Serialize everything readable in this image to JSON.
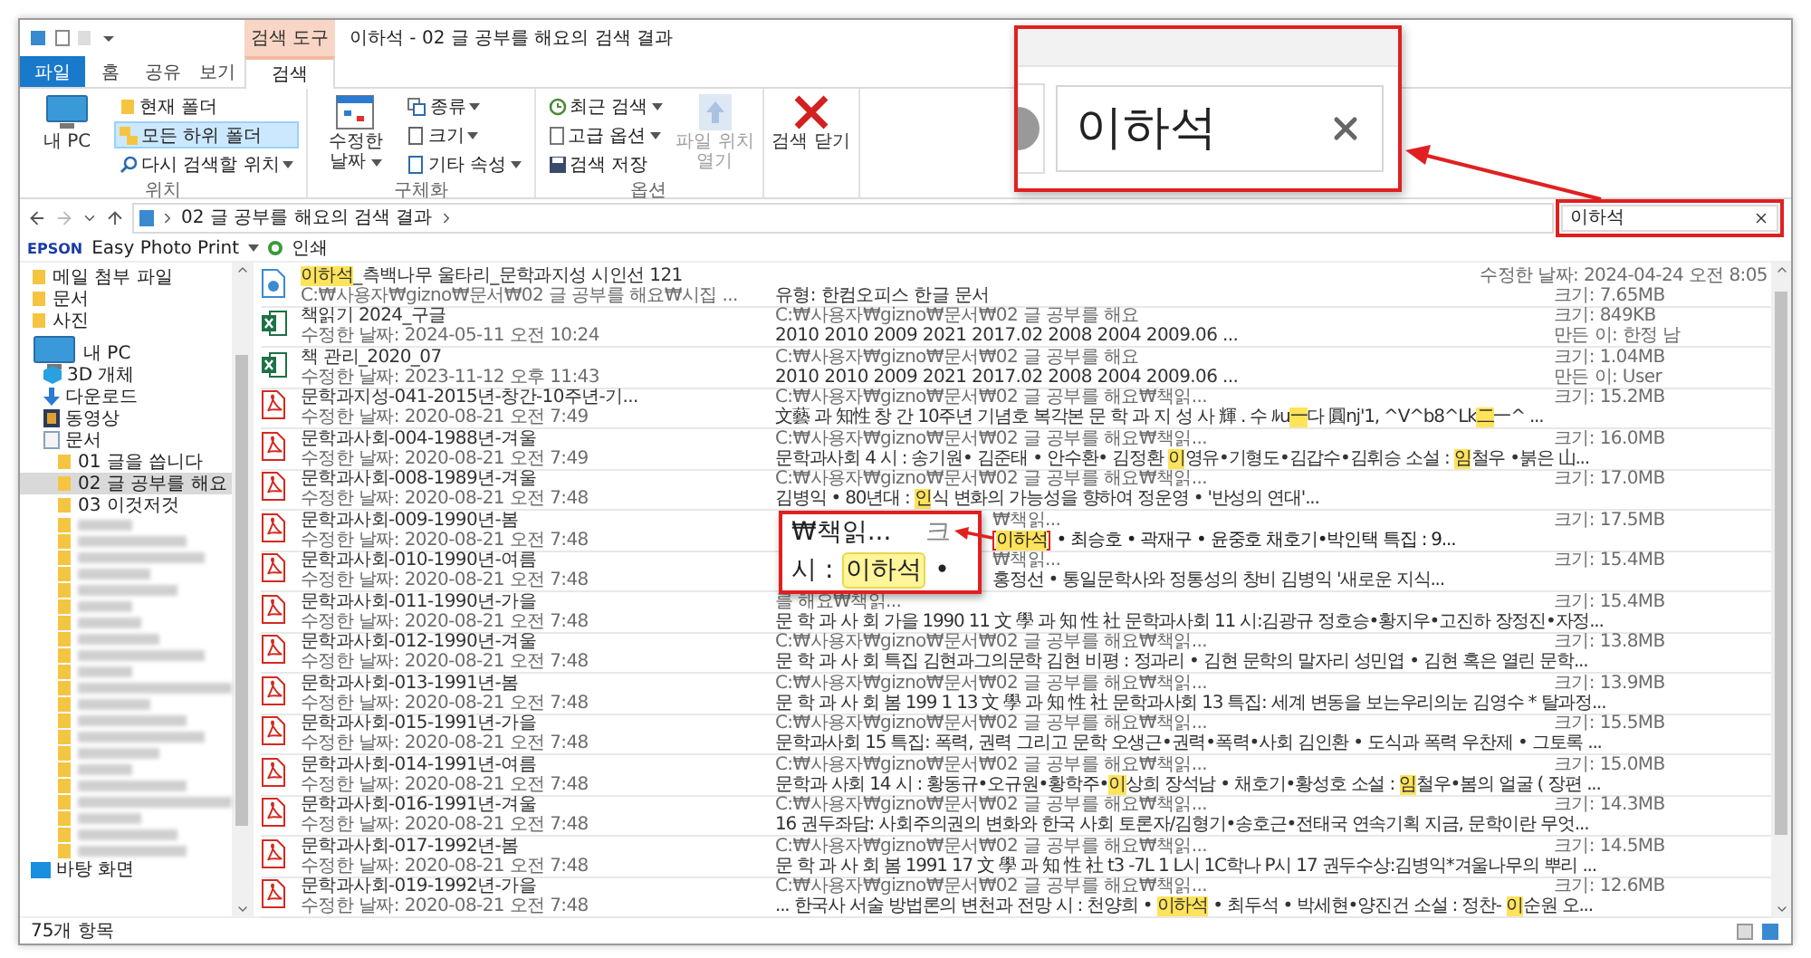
{
  "window": {
    "title": "이하석 - 02 글 공부를 해요의 검색 결과",
    "context_tab": "검색 도구"
  },
  "ribbon_tabs": [
    {
      "label": "파일",
      "kind": "file",
      "selected": false
    },
    {
      "label": "홈",
      "kind": "tab",
      "selected": false
    },
    {
      "label": "공유",
      "kind": "tab",
      "selected": false
    },
    {
      "label": "보기",
      "kind": "tab",
      "selected": false
    },
    {
      "label": "검색",
      "kind": "tab",
      "selected": true
    }
  ],
  "ribbon_groups": [
    {
      "label": "위치",
      "large": [
        {
          "label": "내 PC",
          "disabled": false,
          "dropdown": false
        }
      ],
      "small": [
        {
          "label": "현재 폴더",
          "selected": false,
          "dropdown": false
        },
        {
          "label": "모든 하위 폴더",
          "selected": true,
          "dropdown": false
        },
        {
          "label": "다시 검색할 위치",
          "selected": false,
          "dropdown": true
        }
      ]
    },
    {
      "label": "구체화",
      "large": [
        {
          "label": "수정한 날짜",
          "disabled": false,
          "dropdown": true
        }
      ],
      "small": [
        {
          "label": "종류",
          "selected": false,
          "dropdown": true
        },
        {
          "label": "크기",
          "selected": false,
          "dropdown": true
        },
        {
          "label": "기타 속성",
          "selected": false,
          "dropdown": true
        }
      ]
    },
    {
      "label": "옵션",
      "small": [
        {
          "label": "최근 검색",
          "selected": false,
          "dropdown": true
        },
        {
          "label": "고급 옵션",
          "selected": false,
          "dropdown": true
        },
        {
          "label": "검색 저장",
          "selected": false,
          "dropdown": false
        }
      ],
      "after": [
        {
          "label": "파일 위치 열기",
          "disabled": true
        }
      ]
    },
    {
      "large": [
        {
          "label": "검색 닫기",
          "disabled": false,
          "dropdown": false
        }
      ]
    }
  ],
  "address": {
    "path": "02 글 공부를 해요의 검색 결과"
  },
  "search": {
    "value": "이하석"
  },
  "epson_bar": {
    "brand": "EPSON",
    "app": "Easy Photo Print",
    "print": "인쇄"
  },
  "nav": [
    {
      "label": "메일 첨부 파일",
      "selected": false
    },
    {
      "label": "문서",
      "selected": false
    },
    {
      "label": "사진",
      "selected": false
    },
    {
      "label": "내 PC",
      "selected": false,
      "children": [
        {
          "label": "3D 개체",
          "selected": false
        },
        {
          "label": "다운로드",
          "selected": false
        },
        {
          "label": "동영상",
          "selected": false
        },
        {
          "label": "문서",
          "selected": false,
          "children": [
            {
              "label": "01 글을 씁니다",
              "selected": false
            },
            {
              "label": "02 글 공부를 해요",
              "selected": true
            },
            {
              "label": "03 이것저것",
              "selected": false
            },
            {
              "kind": "blurred",
              "selected": false
            },
            {
              "kind": "blurred",
              "selected": false
            },
            {
              "kind": "blurred",
              "selected": false
            },
            {
              "kind": "blurred",
              "selected": false
            },
            {
              "kind": "blurred",
              "selected": false
            },
            {
              "kind": "blurred",
              "selected": false
            },
            {
              "kind": "blurred",
              "selected": false
            },
            {
              "kind": "blurred",
              "selected": false
            },
            {
              "kind": "blurred",
              "selected": false
            },
            {
              "kind": "blurred",
              "selected": false
            },
            {
              "kind": "blurred",
              "selected": false
            },
            {
              "kind": "blurred",
              "selected": false
            },
            {
              "kind": "blurred",
              "selected": false
            },
            {
              "kind": "blurred",
              "selected": false
            },
            {
              "kind": "blurred",
              "selected": false
            },
            {
              "kind": "blurred",
              "selected": false
            },
            {
              "kind": "blurred",
              "selected": false
            },
            {
              "kind": "blurred",
              "selected": false
            },
            {
              "kind": "blurred",
              "selected": false
            },
            {
              "kind": "blurred",
              "selected": false
            },
            {
              "kind": "blurred",
              "selected": false
            }
          ]
        }
      ]
    },
    {
      "label": "바탕 화면",
      "selected": false
    }
  ],
  "rows": [
    {
      "kind": "hwp",
      "name": "**이하석**_측백나무 울타리_문학과지성 시인선 121",
      "info": "C:₩사용자₩gizno₩문서₩02 글 공부를 해요₩시집 ...",
      "bottom_mid": "유형: 한컴오피스 한글 문서",
      "top_right": "수정한 날짜: 2024-04-24 오전 8:05",
      "bottom_right": "크기: 7.65MB"
    },
    {
      "kind": "excel",
      "name": "책읽기 2024_구글",
      "info": "수정한 날짜: 2024-05-11 오전 10:24",
      "top_mid": "C:₩사용자₩gizno₩문서₩02 글 공부를 해요",
      "bottom_mid": "2010 2010 2009 2021 2017.02 2008 2004 2009.06 ...",
      "top_right": "크기: 849KB",
      "bottom_right": "만든 이: 한정 남"
    },
    {
      "kind": "excel",
      "name": "책 관리_2020_07",
      "info": "수정한 날짜: 2023-11-12 오후 11:43",
      "top_mid": "C:₩사용자₩gizno₩문서₩02 글 공부를 해요",
      "bottom_mid": "2010 2010 2009 2021 2017.02 2008 2004 2009.06 ...",
      "top_right": "크기: 1.04MB",
      "bottom_right": "만든 이: User"
    },
    {
      "kind": "pdf",
      "name": "문학과지성-041-2015년-창간-10주년-기...",
      "info": "수정한 날짜: 2020-08-21 오전 7:49",
      "top_mid": "C:₩사용자₩gizno₩문서₩02 글 공부를 해요₩책읽...",
      "top_right": "크기: 15.2MB",
      "bottom_mid": "文藝 과 知性 창 간 10주년 기념호 복각본 문 학 과 지 성 사 輝 . 수 ﾙu**一**다 圓nj'1, ^V^b8^Lk**二**一^ ..."
    },
    {
      "kind": "pdf",
      "name": "문학과사회-004-1988년-겨울",
      "info": "수정한 날짜: 2020-08-21 오전 7:49",
      "top_mid": "C:₩사용자₩gizno₩문서₩02 글 공부를 해요₩책읽...",
      "top_right": "크기: 16.0MB",
      "bottom_mid": "문학과사회 4 시 : 송기원• 김준태 • 안수환• 김정환 **이**영유•기형도•김갑수•김휘승 소설 : **임**철우 •붉은 山..."
    },
    {
      "kind": "pdf",
      "name": "문학과사회-008-1989년-겨울",
      "info": "수정한 날짜: 2020-08-21 오전 7:48",
      "top_mid": "C:₩사용자₩gizno₩문서₩02 글 공부를 해요₩책읽...",
      "top_right": "크기: 17.0MB",
      "bottom_mid": "김병익 • 80년대 : **인**식 변화의 가능성을 향하여 정운영 • '반성의 연대'..."
    },
    {
      "kind": "pdf",
      "behind_callout": true,
      "name": "문학과사회-009-1990년-봄",
      "info": "수정한 날짜: 2020-08-21 오전 7:48",
      "top_mid": "₩책읽...",
      "top_right": "크기: 17.5MB",
      "marked": "**이하석**",
      "bottom_mid": "• 최승호 • 곽재구 • 윤중호 채호기•박인택 특집 : 9...",
      "zoom": {
        "path": "₩책읽...",
        "label": "크",
        "prefix": "시 :",
        "match": "이하석",
        "bullet": "•"
      }
    },
    {
      "kind": "pdf",
      "behind_callout": true,
      "name": "문학과사회-010-1990년-여름",
      "info": "수정한 날짜: 2020-08-21 오전 7:48",
      "top_mid": "₩책읽...",
      "top_right": "크기: 15.4MB",
      "bottom_mid": "홍정선 • 통일문학사와 정통성의 창비 김병익 '새로운 지식..."
    },
    {
      "kind": "pdf",
      "name": "문학과사회-011-1990년-가을",
      "info": "수정한 날짜: 2020-08-21 오전 7:48",
      "top_mid": "를 해요₩책읽...",
      "top_right": "크기: 15.4MB",
      "bottom_mid": "문 학 과 사 회 가을 1990 11 文 學 과 知 性 社 문학과사회 11 시:김광규 정호승•황지우•고진하 장정진•자정..."
    },
    {
      "kind": "pdf",
      "name": "문학과사회-012-1990년-겨울",
      "info": "수정한 날짜: 2020-08-21 오전 7:48",
      "top_mid": "C:₩사용자₩gizno₩문서₩02 글 공부를 해요₩책읽...",
      "top_right": "크기: 13.8MB",
      "bottom_mid": "문 학 과 사 회 특집 김현과그의문학 김현 비평 : 정과리 • 김현 문학의 말자리 성민엽 • 김현 혹은 열린 문학..."
    },
    {
      "kind": "pdf",
      "name": "문학과사회-013-1991년-봄",
      "info": "수정한 날짜: 2020-08-21 오전 7:48",
      "top_mid": "C:₩사용자₩gizno₩문서₩02 글 공부를 해요₩책읽...",
      "top_right": "크기: 13.9MB",
      "bottom_mid": "문 학 과 사 회 봄 199 1 13 文 學 과 知 性 社 문학과사회 13 특집: 세계 변동을 보는우리의눈 김영수 * 탈과정..."
    },
    {
      "kind": "pdf",
      "name": "문학과사회-015-1991년-가을",
      "info": "수정한 날짜: 2020-08-21 오전 7:48",
      "top_mid": "C:₩사용자₩gizno₩문서₩02 글 공부를 해요₩책읽...",
      "top_right": "크기: 15.5MB",
      "bottom_mid": "문학과사회 15 특집: 폭력, 권력 그리고 문학 오생근•권력•폭력•사회 김인환 • 도식과 폭력 우찬제 • 그토록 ..."
    },
    {
      "kind": "pdf",
      "name": "문학과사회-014-1991년-여름",
      "info": "수정한 날짜: 2020-08-21 오전 7:48",
      "top_mid": "C:₩사용자₩gizno₩문서₩02 글 공부를 해요₩책읽...",
      "top_right": "크기: 15.0MB",
      "bottom_mid": "문학과 사회 14 시 : 황동규•오규원•황학주•**이**상희 장석남 • 채호기•황성호 소설 : **임**철우•봄의 얼굴 ( 장편 ..."
    },
    {
      "kind": "pdf",
      "name": "문학과사회-016-1991년-겨울",
      "info": "수정한 날짜: 2020-08-21 오전 7:48",
      "top_mid": "C:₩사용자₩gizno₩문서₩02 글 공부를 해요₩책읽...",
      "top_right": "크기: 14.3MB",
      "bottom_mid": "16 권두좌담: 사회주의권의 변화와 한국 사회 토론자/김형기•송호근•전태국 연속기획 지금, 문학이란 무엇..."
    },
    {
      "kind": "pdf",
      "name": "문학과사회-017-1992년-봄",
      "info": "수정한 날짜: 2020-08-21 오전 7:48",
      "top_mid": "C:₩사용자₩gizno₩문서₩02 글 공부를 해요₩책읽...",
      "top_right": "크기: 14.5MB",
      "bottom_mid": "문 학 과 사 회 봄 1991 17 文 學 과 知 性 社 t3 -7L 1 L시 1C학나 P시 17 권두수상:김병익*겨울나무의 뿌리 ..."
    },
    {
      "kind": "pdf",
      "name": "문학과사회-019-1992년-가을",
      "info": "수정한 날짜: 2020-08-21 오전 7:48",
      "top_mid": "C:₩사용자₩gizno₩문서₩02 글 공부를 해요₩책읽...",
      "top_right": "크기: 12.6MB",
      "bottom_mid": "... 한국사 서술 방법론의 변천과 전망 시 : 천양희 • **이하석** • 최두석 • 박세현•양진건 소설 : 정찬- **이**순원 오..."
    }
  ],
  "status": {
    "count": "75개 항목"
  },
  "callout": {
    "value": "이하석"
  }
}
